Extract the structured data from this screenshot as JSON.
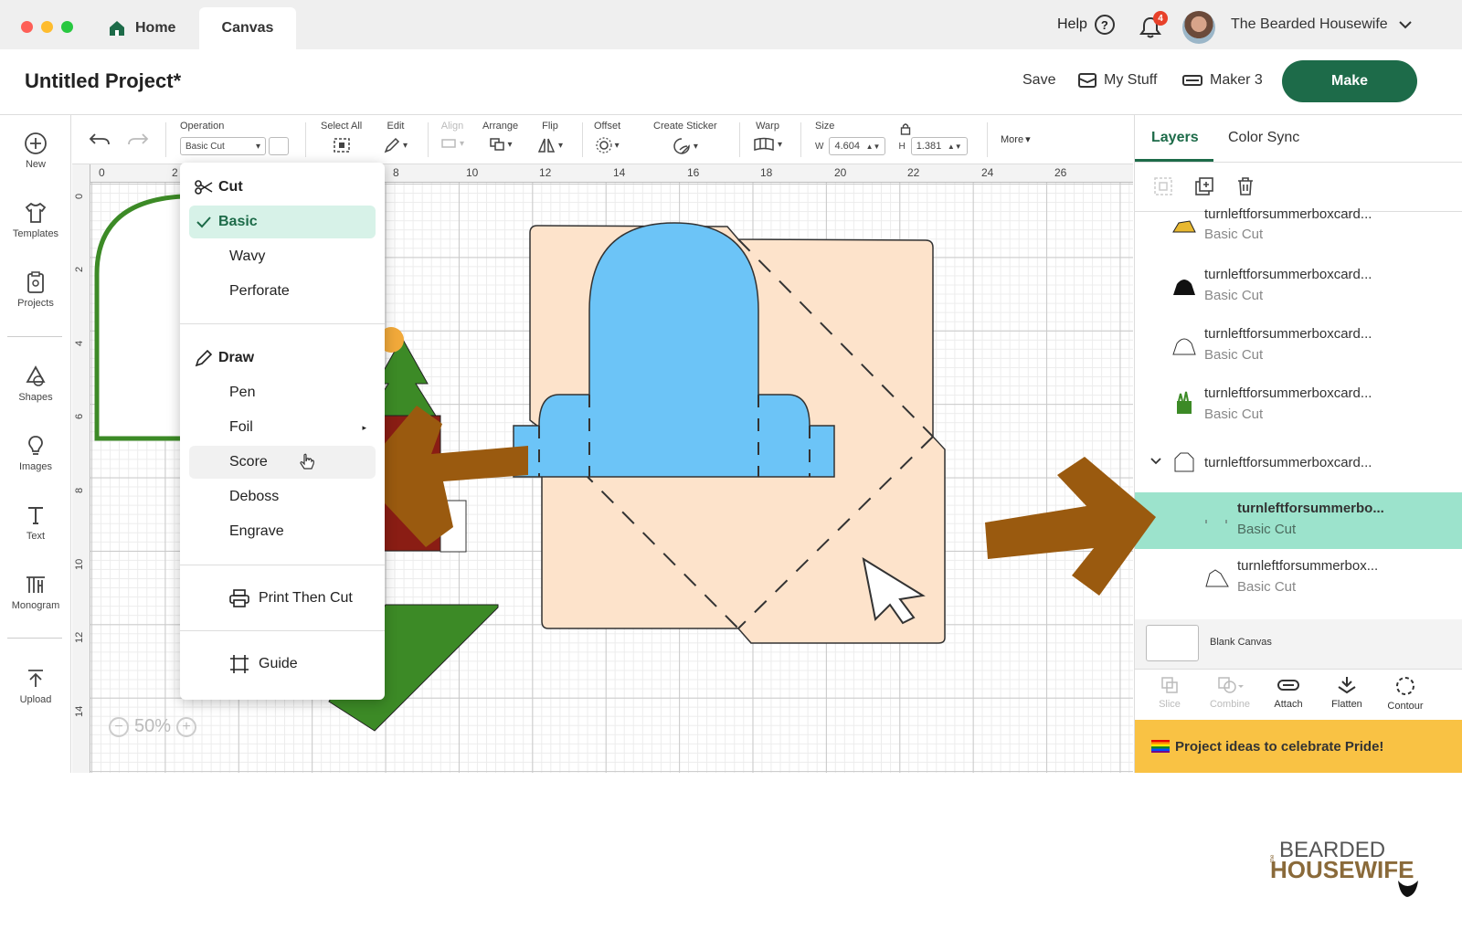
{
  "titlebar": {
    "tabs": {
      "home": "Home",
      "canvas": "Canvas"
    },
    "help_label": "Help",
    "help_icon": "?",
    "notification_count": "4",
    "username": "The Bearded Housewife"
  },
  "header": {
    "project_title": "Untitled Project*",
    "save_label": "Save",
    "my_stuff_label": "My Stuff",
    "machine_label": "Maker 3",
    "make_label": "Make"
  },
  "sidebar": {
    "items": [
      {
        "label": "New",
        "icon": "plus-circle-icon"
      },
      {
        "label": "Templates",
        "icon": "shirt-icon"
      },
      {
        "label": "Projects",
        "icon": "clipboard-icon"
      },
      {
        "label": "Shapes",
        "icon": "shapes-icon"
      },
      {
        "label": "Images",
        "icon": "lightbulb-icon"
      },
      {
        "label": "Text",
        "icon": "text-icon"
      },
      {
        "label": "Monogram",
        "icon": "monogram-icon"
      },
      {
        "label": "Upload",
        "icon": "upload-icon"
      }
    ]
  },
  "toolbar": {
    "operation_label": "Operation",
    "operation_value": "Basic Cut",
    "select_all_label": "Select All",
    "edit_label": "Edit",
    "align_label": "Align",
    "arrange_label": "Arrange",
    "flip_label": "Flip",
    "offset_label": "Offset",
    "create_sticker_label": "Create Sticker",
    "warp_label": "Warp",
    "size_label": "Size",
    "w_label": "W",
    "w_value": "4.604",
    "h_label": "H",
    "h_value": "1.381",
    "more_label": "More"
  },
  "canvas": {
    "ruler_top": [
      "0",
      "2",
      "8",
      "10",
      "12",
      "14",
      "16",
      "18",
      "20",
      "22",
      "24",
      "26"
    ],
    "ruler_left": [
      "0",
      "2",
      "4",
      "6",
      "8",
      "10",
      "12",
      "14"
    ],
    "zoom": "50%",
    "colors": {
      "peach": "#fde3cb",
      "blue": "#6cc4f7",
      "green": "#3c8a26",
      "arrow": "#9a5a0f"
    }
  },
  "operation_menu": {
    "cut_header": "Cut",
    "cut_items": [
      "Basic",
      "Wavy",
      "Perforate"
    ],
    "draw_header": "Draw",
    "draw_items": [
      "Pen",
      "Foil",
      "Score",
      "Deboss",
      "Engrave"
    ],
    "print_then_cut": "Print Then Cut",
    "guide": "Guide",
    "selected": "Basic",
    "hovered": "Score"
  },
  "layers_panel": {
    "tabs": {
      "layers": "Layers",
      "color_sync": "Color Sync"
    },
    "layers": [
      {
        "name": "turnleftforsummerboxcard...",
        "sub": "Basic Cut"
      },
      {
        "name": "turnleftforsummerboxcard...",
        "sub": "Basic Cut"
      },
      {
        "name": "turnleftforsummerboxcard...",
        "sub": "Basic Cut"
      },
      {
        "name": "turnleftforsummerboxcard...",
        "sub": "Basic Cut"
      },
      {
        "name": "turnleftforsummerboxcard...",
        "sub": ""
      },
      {
        "name": "turnleftforsummerbo...",
        "sub": "Basic Cut"
      },
      {
        "name": "turnleftforsummerbox...",
        "sub": "Basic Cut"
      }
    ],
    "blank_canvas": "Blank Canvas",
    "tools": [
      "Slice",
      "Combine",
      "Attach",
      "Flatten",
      "Contour"
    ],
    "promo": "Project ideas to celebrate Pride!",
    "accent": "#1d6b49",
    "selected_color": "#9ce3cc"
  },
  "watermark": {
    "line1": "BEARDED",
    "line2": "HOUSEWIFE",
    "prefix": "the"
  }
}
